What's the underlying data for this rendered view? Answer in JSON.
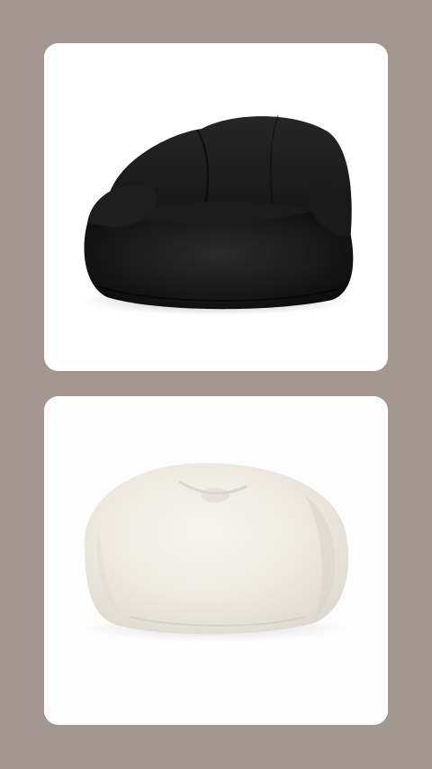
{
  "background_color": "#a39891",
  "cards": [
    {
      "subject": "black-bean-bag-chair",
      "main_color": "#141414"
    },
    {
      "subject": "white-faux-fur-bean-bag",
      "main_color": "#f3f0e9"
    }
  ]
}
